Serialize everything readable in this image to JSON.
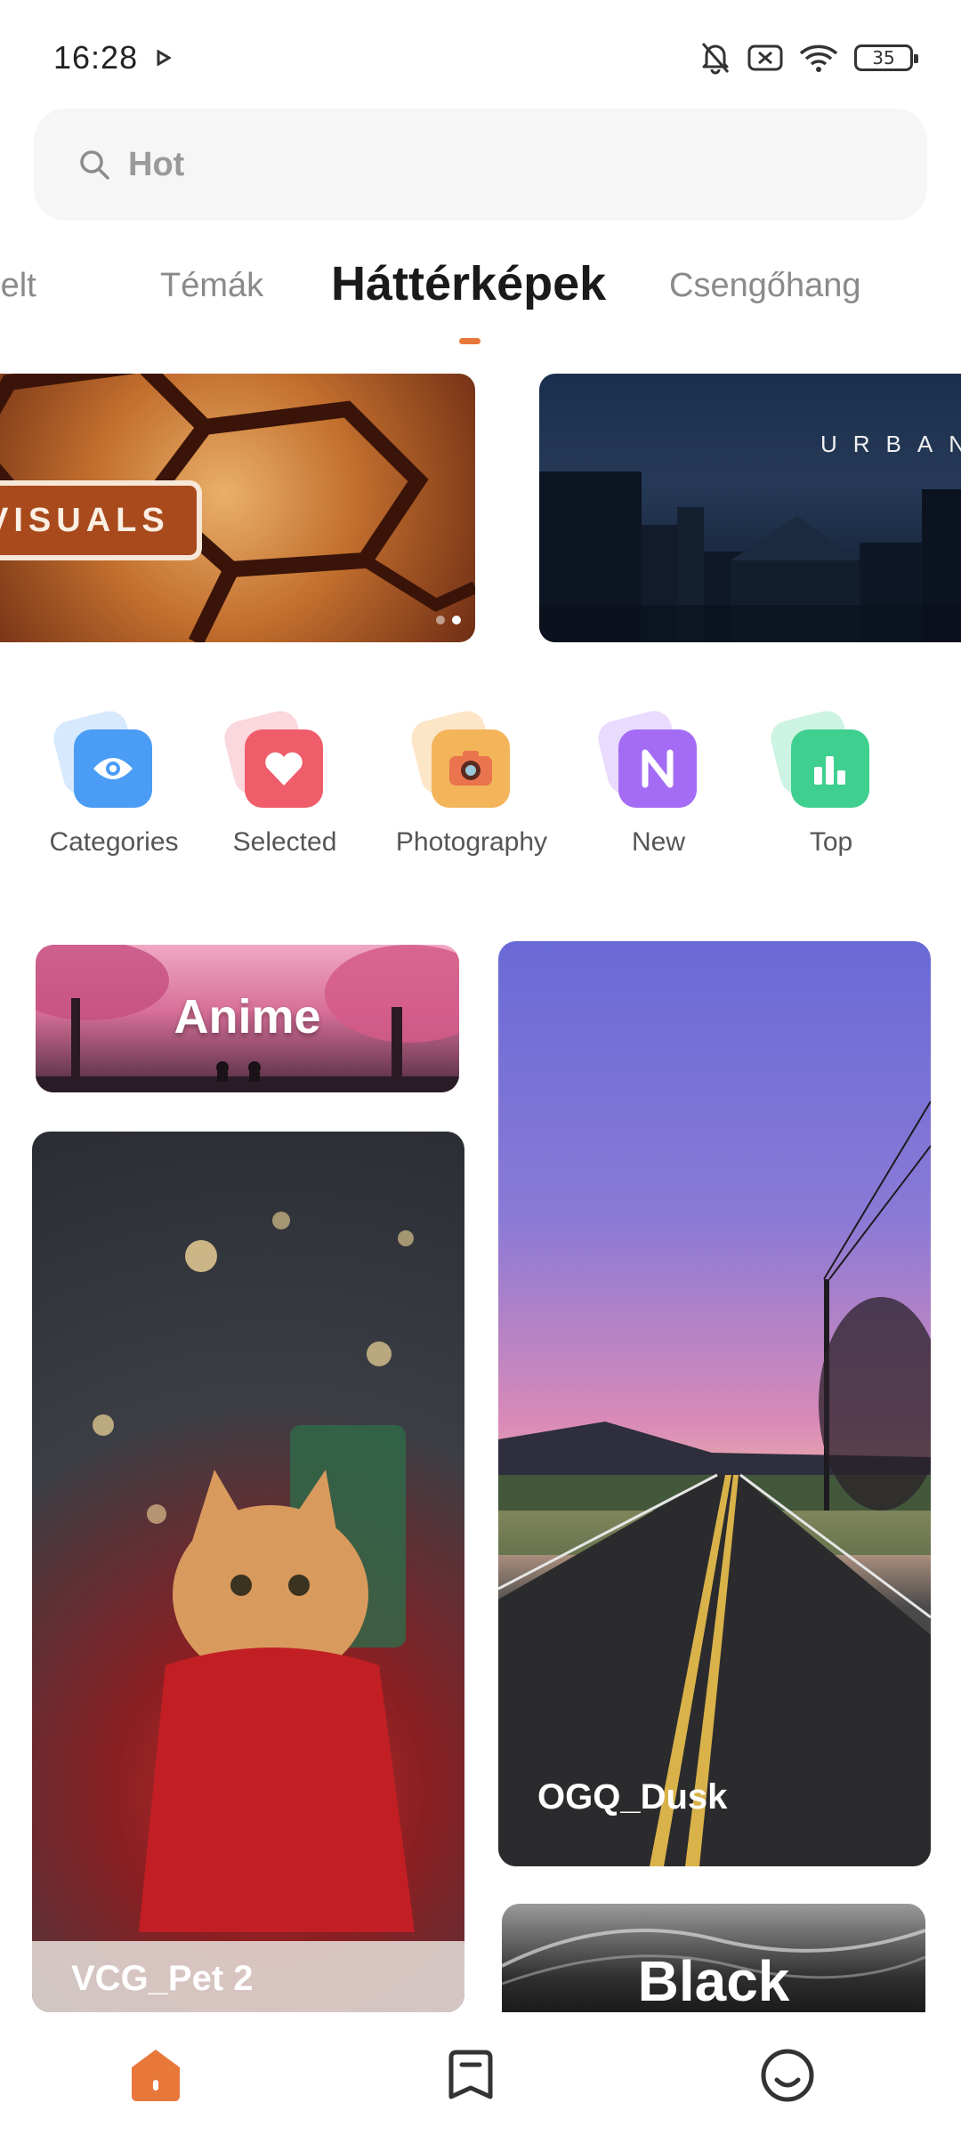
{
  "status_bar": {
    "time": "16:28",
    "battery": "35"
  },
  "search": {
    "placeholder": "Hot"
  },
  "tabs": [
    {
      "label": "Kiemelt"
    },
    {
      "label": "Témák"
    },
    {
      "label": "Háttérképek",
      "active": true
    },
    {
      "label": "Csengőhang"
    }
  ],
  "banners": [
    {
      "tag": "VISUALS"
    },
    {
      "text": "URBAN"
    }
  ],
  "categories": [
    {
      "label": "Categories",
      "icon": "eye-icon",
      "color": "#4a9cf5"
    },
    {
      "label": "Selected",
      "icon": "heart-icon",
      "color": "#ef5d6b"
    },
    {
      "label": "Photography",
      "icon": "camera-icon",
      "color": "#f3b45a"
    },
    {
      "label": "New",
      "icon": "n-letter-icon",
      "color": "#a46cf5"
    },
    {
      "label": "Top",
      "icon": "bar-chart-icon",
      "color": "#3fcf8e"
    }
  ],
  "cards": {
    "anime": "Anime",
    "pet": "VCG_Pet 2",
    "dusk": "OGQ_Dusk",
    "black": "Black"
  },
  "colors": {
    "accent": "#e8773a"
  }
}
